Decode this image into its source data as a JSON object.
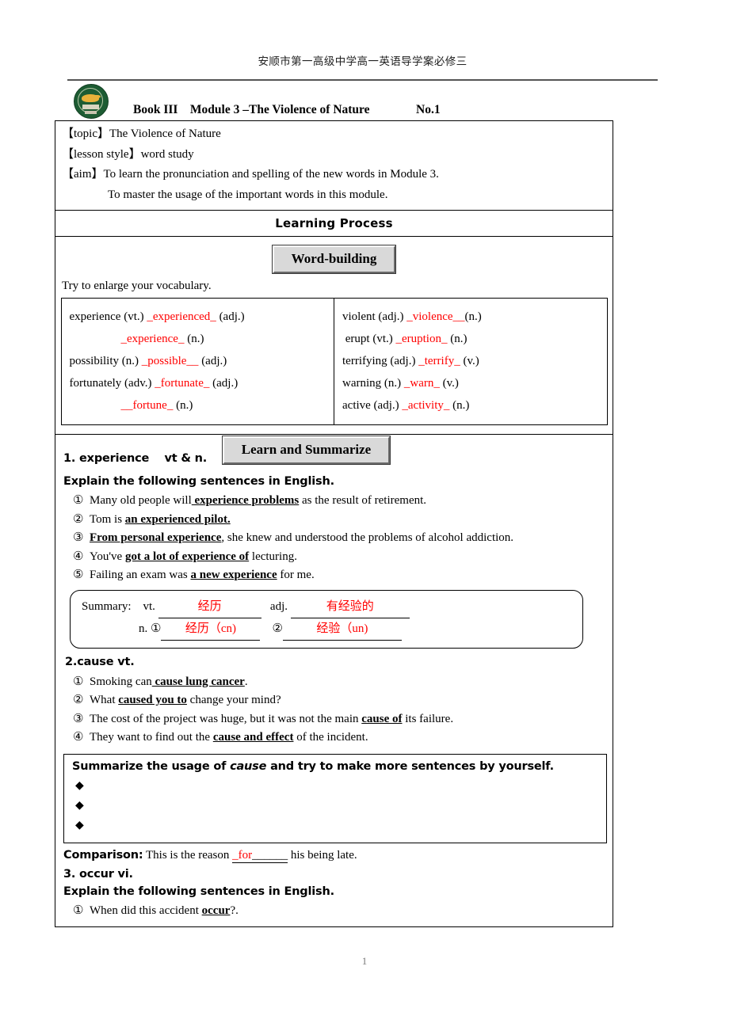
{
  "header": {
    "running_title": "安顺市第一高级中学高一英语导学案必修三",
    "book_title": "Book III    Module 3 –The Violence of Nature",
    "number": "No.1",
    "emblem_color": "#1d5c33"
  },
  "topic": {
    "lines": [
      "【topic】The Violence of Nature",
      "【lesson style】word study",
      "【aim】To learn the pronunciation and spelling of the new words in Module 3."
    ],
    "aim_second_line": "To master the usage of the important words in this module."
  },
  "learning_process": {
    "title": "Learning Process"
  },
  "word_building": {
    "button_label": "Word-building",
    "lead": "Try to enlarge your vocabulary.",
    "left_column": [
      {
        "text": "experience (vt.) ",
        "answer": "_experienced_",
        "tail": " (adj.)",
        "indent": false
      },
      {
        "text": "",
        "answer": "_experience_",
        "tail": " (n.)",
        "indent": true
      },
      {
        "text": "possibility (n.) ",
        "answer": "_possible__",
        "tail": " (adj.)",
        "indent": false
      },
      {
        "text": "fortunately (adv.) ",
        "answer": "_fortunate_",
        "tail": " (adj.)",
        "indent": false
      },
      {
        "text": "",
        "answer": "__fortune_",
        "tail": " (n.)",
        "indent": true
      }
    ],
    "right_column": [
      {
        "text": "violent (adj.) ",
        "answer": "_violence__",
        "tail": "(n.)",
        "indent": false
      },
      {
        "text": " erupt (vt.) ",
        "answer": "_eruption_",
        "tail": " (n.)",
        "indent": false
      },
      {
        "text": "terrifying (adj.) ",
        "answer": "_terrify_",
        "tail": " (v.)",
        "indent": false
      },
      {
        "text": "warning (n.) ",
        "answer": "_warn_",
        "tail": " (v.)",
        "indent": false
      },
      {
        "text": "active (adj.) ",
        "answer": "_activity_",
        "tail": " (n.)",
        "indent": false
      }
    ]
  },
  "section1": {
    "heading": "1. experience    vt & n.",
    "button_label": "Learn and Summarize",
    "explain_label": "Explain the following sentences in English.",
    "sentences": [
      {
        "num": "①",
        "pre": "Many old people will",
        "bold": " experience problems",
        "post": " as the result of retirement."
      },
      {
        "num": "②",
        "pre": "Tom is ",
        "bold": "an experienced pilot.",
        "post": ""
      },
      {
        "num": "③",
        "pre": "",
        "bold": "From personal experience",
        "post": ", she knew and understood the problems of alcohol addiction."
      },
      {
        "num": "④",
        "pre": "You've ",
        "bold": "got a lot of experience of",
        "post": " lecturing."
      },
      {
        "num": "⑤",
        "pre": "Failing an exam was ",
        "bold": "a new experience",
        "post": " for me."
      }
    ],
    "summary": {
      "label": "Summary:",
      "vt_label": "vt.",
      "vt_answer": "经历",
      "adj_label": "adj.",
      "adj_answer": "有经验的",
      "n_label": "n.",
      "n_first_num": "①",
      "n_first_answer": "经历（cn)",
      "n_second_num": "②",
      "n_second_answer": "经验（un)"
    }
  },
  "section2": {
    "heading": "2.cause vt.",
    "sentences": [
      {
        "num": "①",
        "pre": "Smoking can",
        "bold": " cause lung cancer",
        "post": "."
      },
      {
        "num": "②",
        "pre": "What ",
        "bold": "caused you to",
        "post": " change your mind?"
      },
      {
        "num": "③",
        "pre": "The cost of the project was huge, but it was not the main ",
        "bold": "cause of",
        "post": " its failure."
      },
      {
        "num": "④",
        "pre": "They want to find out the ",
        "bold": "cause and effect",
        "post": " of the incident."
      }
    ],
    "usage_box": {
      "title_pre": "Summarize the usage of ",
      "title_italic": "cause",
      "title_post": " and try to make more sentences by yourself.",
      "bullets": [
        "◆",
        "◆",
        "◆"
      ]
    },
    "comparison": {
      "label": "Comparison:",
      "pre": " This is the reason ",
      "answer": "_for",
      "blank": "______",
      "post": " his being late."
    }
  },
  "section3": {
    "heading": "3. occur vi.",
    "explain_label": "Explain the following sentences in English.",
    "sentences": [
      {
        "num": "①",
        "pre": "When did this accident ",
        "bold": "occur",
        "post": "?."
      }
    ]
  },
  "footer": {
    "page_number": "1"
  }
}
